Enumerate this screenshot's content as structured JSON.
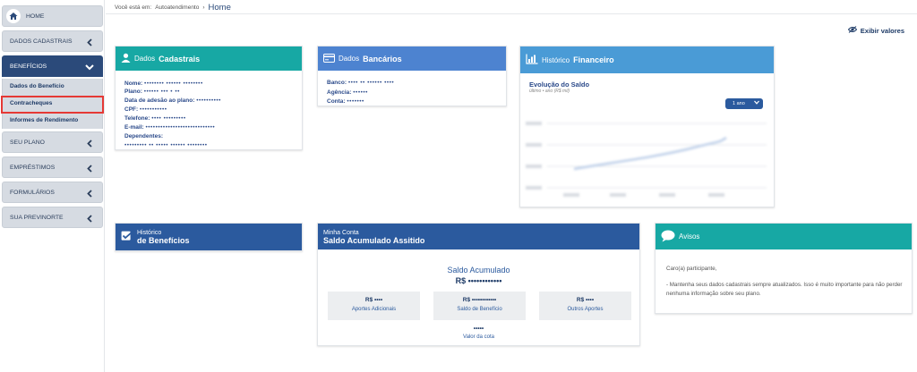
{
  "breadcrumb": {
    "prefix": "Você está em:",
    "section": "Autoatendimento",
    "current": "Home"
  },
  "toolbar": {
    "show_values": "Exibir valores"
  },
  "sidebar": {
    "home": "HOME",
    "items": [
      {
        "label": "DADOS CADASTRAIS"
      },
      {
        "label": "BENEFÍCIOS"
      },
      {
        "label": "SEU PLANO"
      },
      {
        "label": "EMPRÉSTIMOS"
      },
      {
        "label": "FORMULÁRIOS"
      },
      {
        "label": "SUA PREVINORTE"
      }
    ],
    "submenu": [
      {
        "label": "Dados do Benefício"
      },
      {
        "label": "Contracheques"
      },
      {
        "label": "Informes de Rendimento"
      }
    ]
  },
  "dados_cadastrais": {
    "title_light": "Dados",
    "title_bold": "Cadastrais",
    "fields": [
      {
        "label": "Nome:",
        "value": "•••••••• •••••• ••••••••"
      },
      {
        "label": "Plano:",
        "value": "•••••• ••• • ••"
      },
      {
        "label": "Data de adesão ao plano:",
        "value": "••••••••••"
      },
      {
        "label": "CPF:",
        "value": "•••••••••••"
      },
      {
        "label": "Telefone:",
        "value": "•••• •••••••••"
      },
      {
        "label": "E-mail:",
        "value": "••••••••••••••••••••••••••••"
      },
      {
        "label": "Dependentes:",
        "value": ""
      },
      {
        "label": "",
        "value": "••••••••• •• ••••• •••••• ••••••••"
      }
    ]
  },
  "dados_bancarios": {
    "title_light": "Dados",
    "title_bold": "Bancários",
    "fields": [
      {
        "label": "Banco:",
        "value": "•••• •• •••••• ••••"
      },
      {
        "label": "Agência:",
        "value": "••••••"
      },
      {
        "label": "Conta:",
        "value": "•••••••"
      }
    ]
  },
  "historico_financeiro": {
    "title_light": "Histórico",
    "title_bold": "Financeiro",
    "chart_title": "Evolução do Saldo",
    "chart_subtitle": "último • ano (R$ mil)",
    "period": "1 ano"
  },
  "historico_beneficios": {
    "title_line1": "Histórico",
    "title_line2": "de Benefícios"
  },
  "saldo": {
    "title_line1": "Minha Conta",
    "title_line2": "Saldo Acumulado Assitido",
    "label": "Saldo Acumulado",
    "value": "R$ ••••••••••••",
    "boxes": [
      {
        "value": "R$ ••••",
        "label": "Aportes Adicionais"
      },
      {
        "value": "R$ ••••••••••••",
        "label": "Saldo de Benefício"
      },
      {
        "value": "R$ ••••",
        "label": "Outros Aportes"
      }
    ],
    "cota_value": "•••••",
    "cota_label": "Valor da cota"
  },
  "avisos": {
    "title": "Avisos",
    "greeting": "Caro(a) participante,",
    "message": "- Mantenha seus dados cadastrais sempre atualizados. Isso é muito importante para não perder nenhuma informação sobre seu plano."
  },
  "colors": {
    "teal": "#17a8a4",
    "navy": "#2b4a7a",
    "blue": "#4d83d0",
    "alert": "#e53935"
  }
}
